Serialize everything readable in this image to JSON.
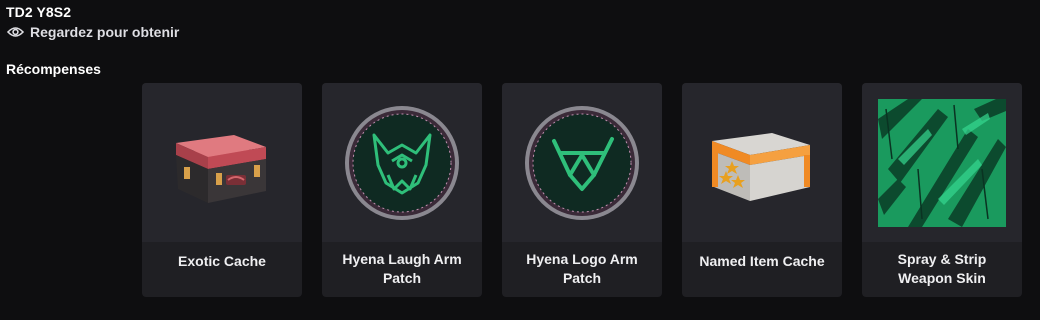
{
  "campaign": {
    "title": "TD2 Y8S2",
    "watch_label": "Regardez pour obtenir",
    "watch_icon": "eye-icon"
  },
  "rewards_section": {
    "title": "Récompenses",
    "items": [
      {
        "label": "Exotic Cache",
        "image": "exotic-cache-image"
      },
      {
        "label": "Hyena Laugh Arm Patch",
        "image": "hyena-laugh-patch-image"
      },
      {
        "label": "Hyena Logo Arm Patch",
        "image": "hyena-logo-patch-image"
      },
      {
        "label": "Named Item Cache",
        "image": "named-item-cache-image"
      },
      {
        "label": "Spray & Strip Weapon Skin",
        "image": "spray-strip-skin-image"
      }
    ]
  },
  "colors": {
    "background": "#0e0e10",
    "card": "#1f1f23",
    "card_image": "#26262c",
    "patch_green": "#2fbf7a",
    "exotic_red": "#c8505a",
    "named_orange": "#f08a24"
  }
}
